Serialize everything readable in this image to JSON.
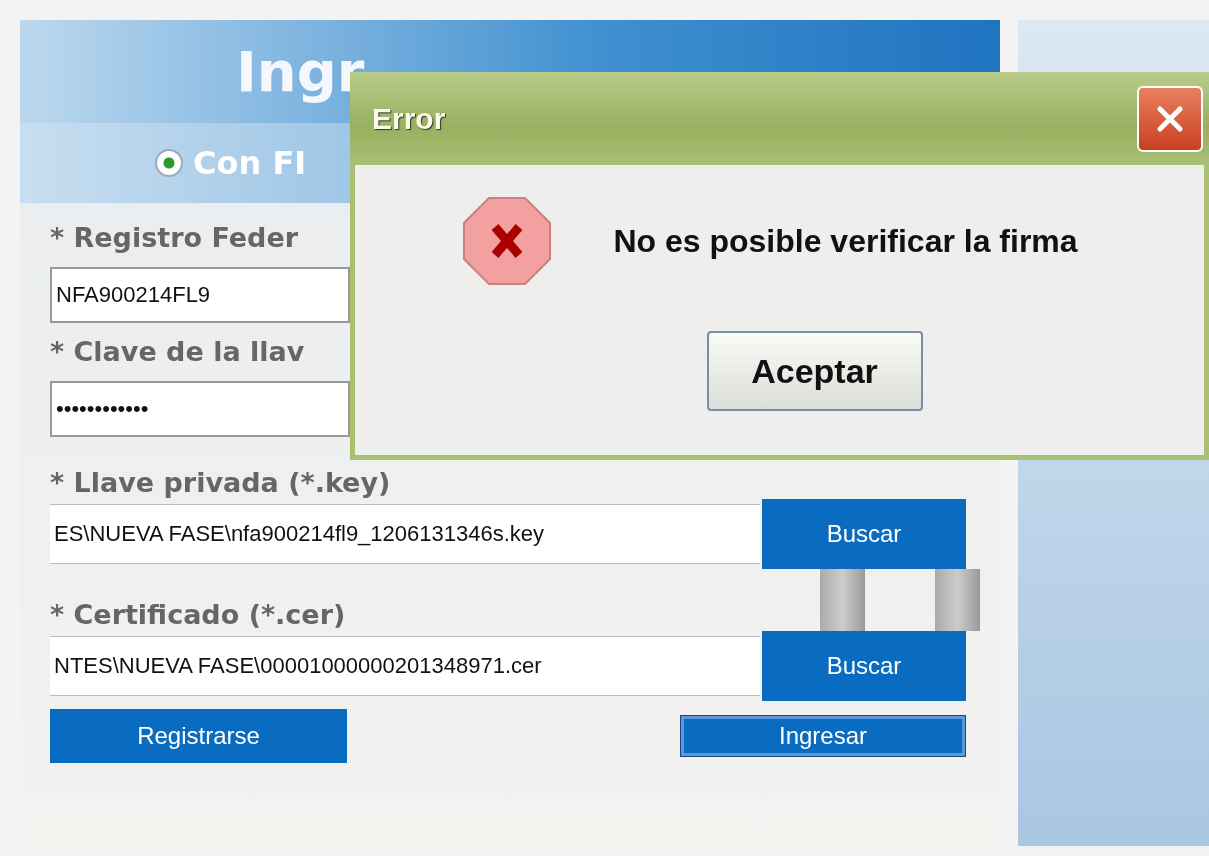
{
  "login_panel": {
    "title": "Ingr",
    "login_option": {
      "label": "Con FI",
      "selected": true
    },
    "fields": [
      {
        "kind": "text",
        "label": "* Registro Feder",
        "value": "NFA900214FL9"
      },
      {
        "kind": "text",
        "label": "* Clave de la llav",
        "value": "••••••••••••"
      },
      {
        "kind": "file",
        "label": "* Llave privada (*.key)",
        "value": "ES\\NUEVA FASE\\nfa900214fl9_1206131346s.key",
        "button": "Buscar"
      },
      {
        "kind": "file",
        "label": "* Certificado (*.cer)",
        "value": "NTES\\NUEVA FASE\\00001000000201348971.cer",
        "button": "Buscar"
      }
    ],
    "buttons": [
      "Registrarse",
      "Ingresar"
    ]
  },
  "dialog": {
    "title": "Error",
    "message": "No es posible verificar la firma",
    "button": "Aceptar"
  }
}
